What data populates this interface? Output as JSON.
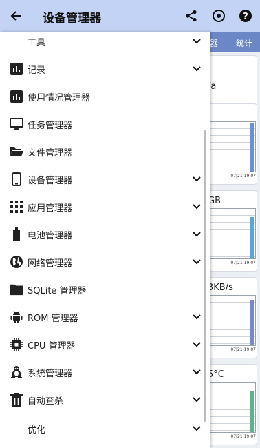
{
  "appbar": {
    "title": "设备管理器",
    "icons": [
      "back-arrow-icon",
      "share-icon",
      "record-target-icon",
      "help-icon"
    ]
  },
  "background": {
    "tabs": [
      "器",
      "统计"
    ],
    "cards": [
      {
        "value": "/a",
        "timestamp": ""
      },
      {
        "value": "",
        "timestamp": "07|21:19:07"
      },
      {
        "value": "GB",
        "timestamp": "07|21:19:07"
      },
      {
        "value": "3KB/s",
        "timestamp": "07|21:19:07"
      },
      {
        "value": "5°C",
        "timestamp": "07|21:19:07"
      }
    ],
    "bar_colors": [
      "#6b8fcf",
      "#5aa7d6",
      "#7a87c8",
      "#63b08c"
    ]
  },
  "drawer": {
    "items": [
      {
        "label": "工具",
        "icon": "",
        "expandable": true
      },
      {
        "label": "记录",
        "icon": "bar-chart-icon",
        "expandable": true
      },
      {
        "label": "使用情况管理器",
        "icon": "bar-chart-icon",
        "expandable": false
      },
      {
        "label": "任务管理器",
        "icon": "cast-screen-icon",
        "expandable": false
      },
      {
        "label": "文件管理器",
        "icon": "folder-open-icon",
        "expandable": false
      },
      {
        "label": "设备管理器",
        "icon": "smartphone-icon",
        "expandable": true
      },
      {
        "label": "应用管理器",
        "icon": "app-grid-icon",
        "expandable": true
      },
      {
        "label": "电池管理器",
        "icon": "battery-icon",
        "expandable": true
      },
      {
        "label": "网络管理器",
        "icon": "globe-icon",
        "expandable": true
      },
      {
        "label": "SQLite 管理器",
        "icon": "folder-icon",
        "expandable": false
      },
      {
        "label": "ROM 管理器",
        "icon": "android-icon",
        "expandable": true
      },
      {
        "label": "CPU 管理器",
        "icon": "cpu-chip-icon",
        "expandable": true
      },
      {
        "label": "系统管理器",
        "icon": "linux-penguin-icon",
        "expandable": true
      },
      {
        "label": "自动查杀",
        "icon": "trash-icon",
        "expandable": true
      },
      {
        "label": "优化",
        "icon": "",
        "expandable": true
      }
    ]
  }
}
